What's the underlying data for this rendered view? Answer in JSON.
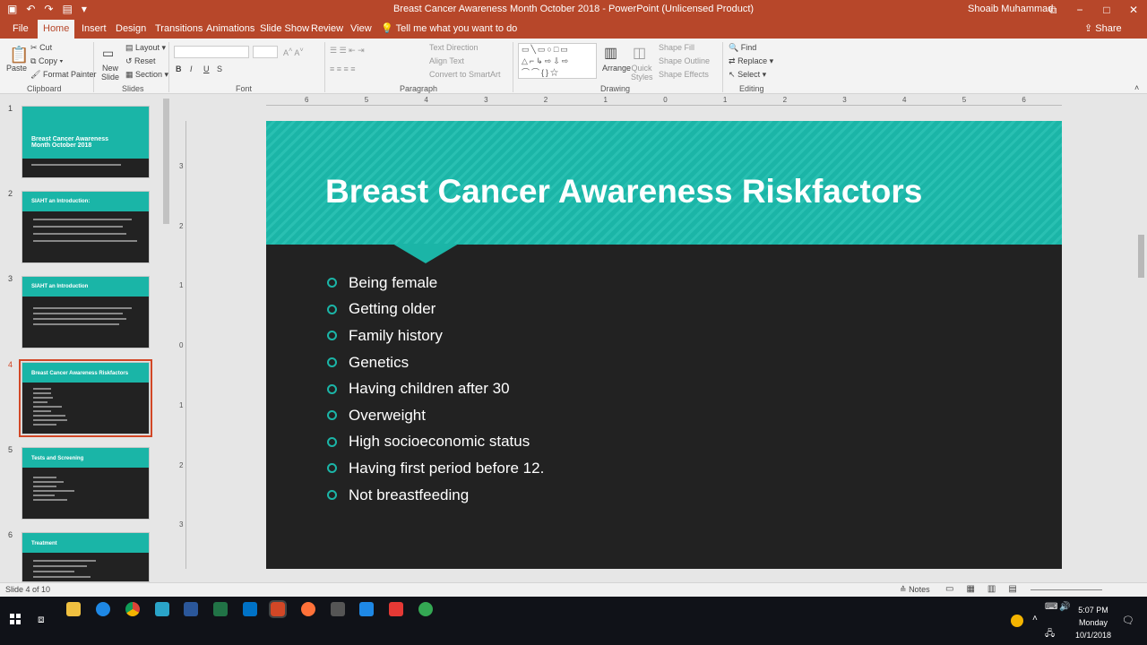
{
  "titlebar": {
    "title": "Breast Cancer Awareness Month October 2018  -  PowerPoint (Unlicensed Product)",
    "user": "Shoaib Muhammad",
    "minimize": "−",
    "restore": "□",
    "close": "✕",
    "ribbon_display": "⧉"
  },
  "tabs": [
    {
      "label": "File"
    },
    {
      "label": "Home"
    },
    {
      "label": "Insert"
    },
    {
      "label": "Design"
    },
    {
      "label": "Transitions"
    },
    {
      "label": "Animations"
    },
    {
      "label": "Slide Show"
    },
    {
      "label": "Review"
    },
    {
      "label": "View"
    }
  ],
  "tell_me": "Tell me what you want to do",
  "share": "Share",
  "ribbon": {
    "paste": "Paste",
    "cut": "Cut",
    "copy": "Copy",
    "format_painter": "Format Painter",
    "clipboard": "Clipboard",
    "new_slide": "New Slide",
    "layout": "Layout",
    "reset": "Reset",
    "section": "Section",
    "slides": "Slides",
    "font": "Font",
    "text_direction": "Text Direction",
    "align_text": "Align Text",
    "convert_smartart": "Convert to SmartArt",
    "paragraph": "Paragraph",
    "arrange": "Arrange",
    "quick_styles": "Quick Styles",
    "shape_fill": "Shape Fill",
    "shape_outline": "Shape Outline",
    "shape_effects": "Shape Effects",
    "drawing": "Drawing",
    "find": "Find",
    "replace": "Replace",
    "select": "Select",
    "editing": "Editing",
    "bold": "B",
    "italic": "I",
    "underline": "U",
    "strikethrough": "S"
  },
  "ruler": {
    "h_labels": [
      "6",
      "5",
      "4",
      "3",
      "2",
      "1",
      "0",
      "1",
      "2",
      "3",
      "4",
      "5",
      "6"
    ],
    "v_labels": [
      "3",
      "2",
      "1",
      "0",
      "1",
      "2",
      "3"
    ]
  },
  "thumbnails": [
    {
      "num": "1",
      "title": "Breast Cancer Awareness Month October 2018"
    },
    {
      "num": "2",
      "title": "SIAHT an Introduction:"
    },
    {
      "num": "3",
      "title": "SIAHT an Introduction"
    },
    {
      "num": "4",
      "title": "Breast Cancer Awareness Riskfactors"
    },
    {
      "num": "5",
      "title": "Tests and Screening"
    },
    {
      "num": "6",
      "title": "Treatment"
    }
  ],
  "slide": {
    "title": "Breast Cancer Awareness Riskfactors",
    "bullets": [
      "Being female",
      "Getting older",
      "Family history",
      "Genetics",
      "Having children after 30",
      "Overweight",
      "High socioeconomic status",
      "Having first period before 12.",
      "Not breastfeeding"
    ]
  },
  "status": {
    "slide_of": "Slide 4 of 10",
    "notes": "Notes"
  },
  "clock": {
    "time": "5:07 PM",
    "day": "Monday",
    "date": "10/1/2018"
  },
  "colors": {
    "accent": "#b7472a",
    "teal": "#1bb5a7",
    "slide_bg": "#222222"
  }
}
